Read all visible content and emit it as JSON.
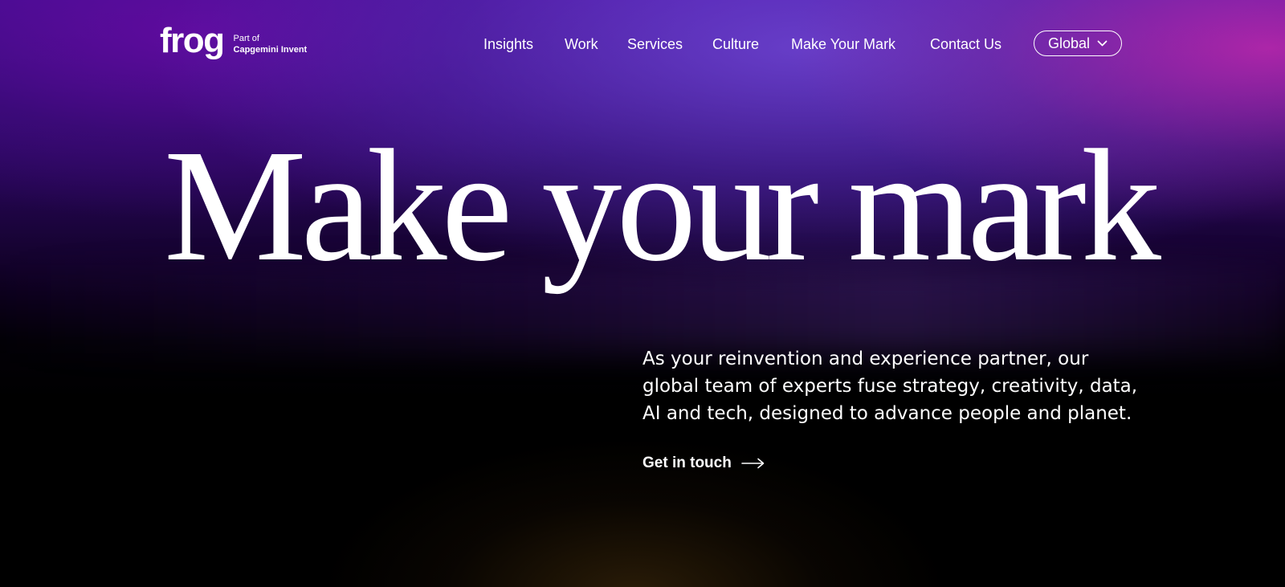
{
  "brand": {
    "logo_text": "frog",
    "tagline_line1": "Part of",
    "tagline_line2": "Capgemini Invent"
  },
  "nav": {
    "items": [
      {
        "label": "Insights"
      },
      {
        "label": "Work"
      },
      {
        "label": "Services"
      },
      {
        "label": "Culture"
      },
      {
        "label": "Make Your Mark"
      },
      {
        "label": "Contact Us"
      }
    ],
    "region_label": "Global",
    "region_icon": "chevron-down-icon"
  },
  "hero": {
    "headline": "Make your mark",
    "intro_lines": [
      "As your reinvention and experience partner, our",
      "global team of experts fuse strategy, creativity, data,",
      "AI and tech, designed to advance people and planet."
    ],
    "cta_label": "Get in touch",
    "cta_icon": "arrow-right-icon"
  },
  "colors": {
    "text": "#ffffff",
    "background": "#000000",
    "accent_purple": "#5a20c0",
    "accent_magenta": "#b0209a"
  }
}
